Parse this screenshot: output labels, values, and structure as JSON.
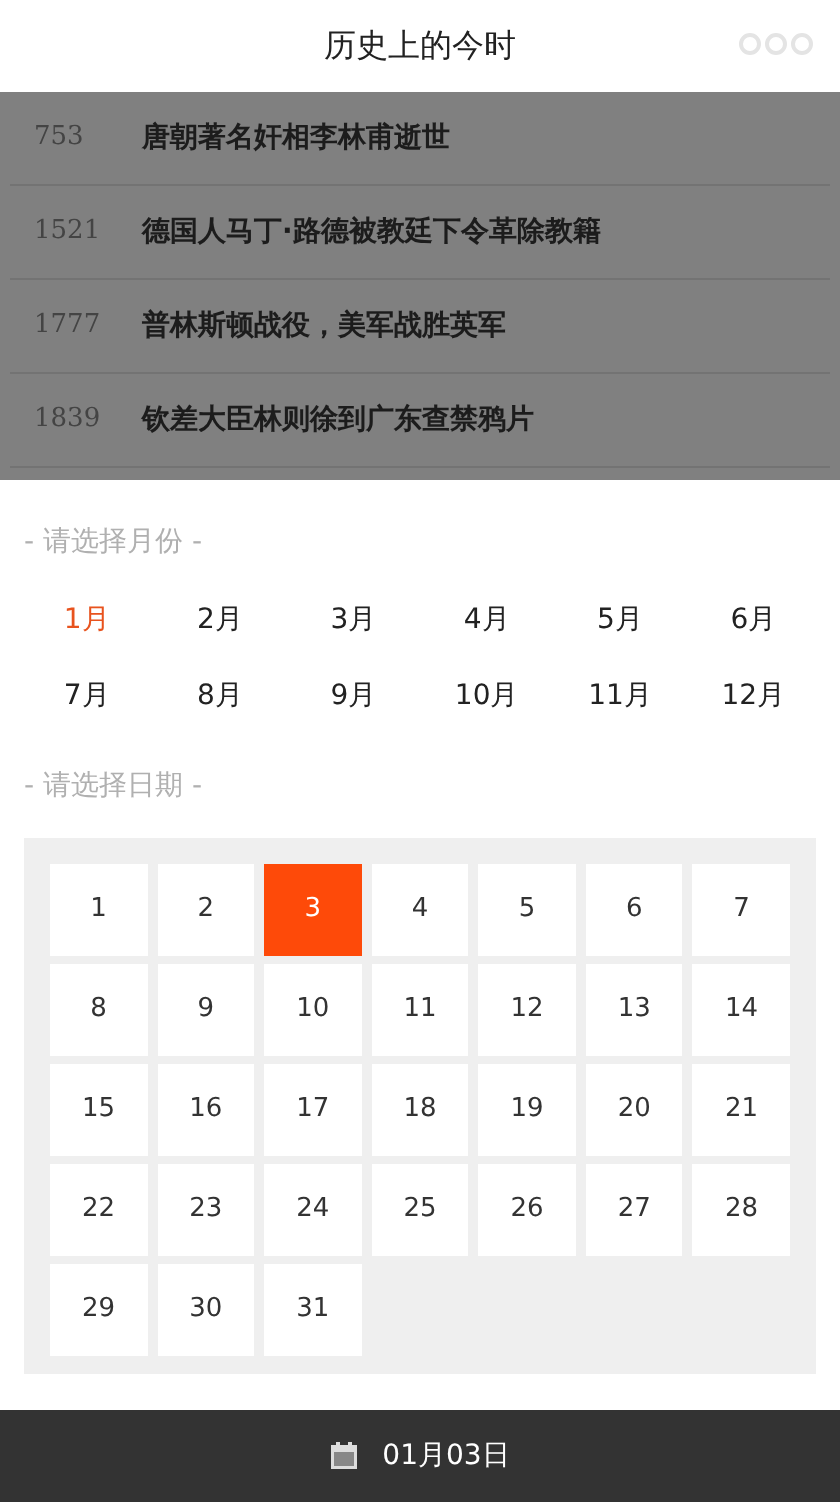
{
  "header": {
    "title": "历史上的今时"
  },
  "events": [
    {
      "year": "753",
      "text": "唐朝著名奸相李林甫逝世"
    },
    {
      "year": "1521",
      "text": "德国人马丁·路德被教廷下令革除教籍"
    },
    {
      "year": "1777",
      "text": "普林斯顿战役，美军战胜英军"
    },
    {
      "year": "1839",
      "text": "钦差大臣林则徐到广东查禁鸦片"
    }
  ],
  "month_section": {
    "label": "- 请选择月份 -"
  },
  "months": [
    {
      "label": "1月",
      "selected": true
    },
    {
      "label": "2月",
      "selected": false
    },
    {
      "label": "3月",
      "selected": false
    },
    {
      "label": "4月",
      "selected": false
    },
    {
      "label": "5月",
      "selected": false
    },
    {
      "label": "6月",
      "selected": false
    },
    {
      "label": "7月",
      "selected": false
    },
    {
      "label": "8月",
      "selected": false
    },
    {
      "label": "9月",
      "selected": false
    },
    {
      "label": "10月",
      "selected": false
    },
    {
      "label": "11月",
      "selected": false
    },
    {
      "label": "12月",
      "selected": false
    }
  ],
  "day_section": {
    "label": "- 请选择日期 -"
  },
  "days": [
    {
      "label": "1",
      "selected": false
    },
    {
      "label": "2",
      "selected": false
    },
    {
      "label": "3",
      "selected": true
    },
    {
      "label": "4",
      "selected": false
    },
    {
      "label": "5",
      "selected": false
    },
    {
      "label": "6",
      "selected": false
    },
    {
      "label": "7",
      "selected": false
    },
    {
      "label": "8",
      "selected": false
    },
    {
      "label": "9",
      "selected": false
    },
    {
      "label": "10",
      "selected": false
    },
    {
      "label": "11",
      "selected": false
    },
    {
      "label": "12",
      "selected": false
    },
    {
      "label": "13",
      "selected": false
    },
    {
      "label": "14",
      "selected": false
    },
    {
      "label": "15",
      "selected": false
    },
    {
      "label": "16",
      "selected": false
    },
    {
      "label": "17",
      "selected": false
    },
    {
      "label": "18",
      "selected": false
    },
    {
      "label": "19",
      "selected": false
    },
    {
      "label": "20",
      "selected": false
    },
    {
      "label": "21",
      "selected": false
    },
    {
      "label": "22",
      "selected": false
    },
    {
      "label": "23",
      "selected": false
    },
    {
      "label": "24",
      "selected": false
    },
    {
      "label": "25",
      "selected": false
    },
    {
      "label": "26",
      "selected": false
    },
    {
      "label": "27",
      "selected": false
    },
    {
      "label": "28",
      "selected": false
    },
    {
      "label": "29",
      "selected": false
    },
    {
      "label": "30",
      "selected": false
    },
    {
      "label": "31",
      "selected": false
    }
  ],
  "footer": {
    "date": "01月03日"
  }
}
